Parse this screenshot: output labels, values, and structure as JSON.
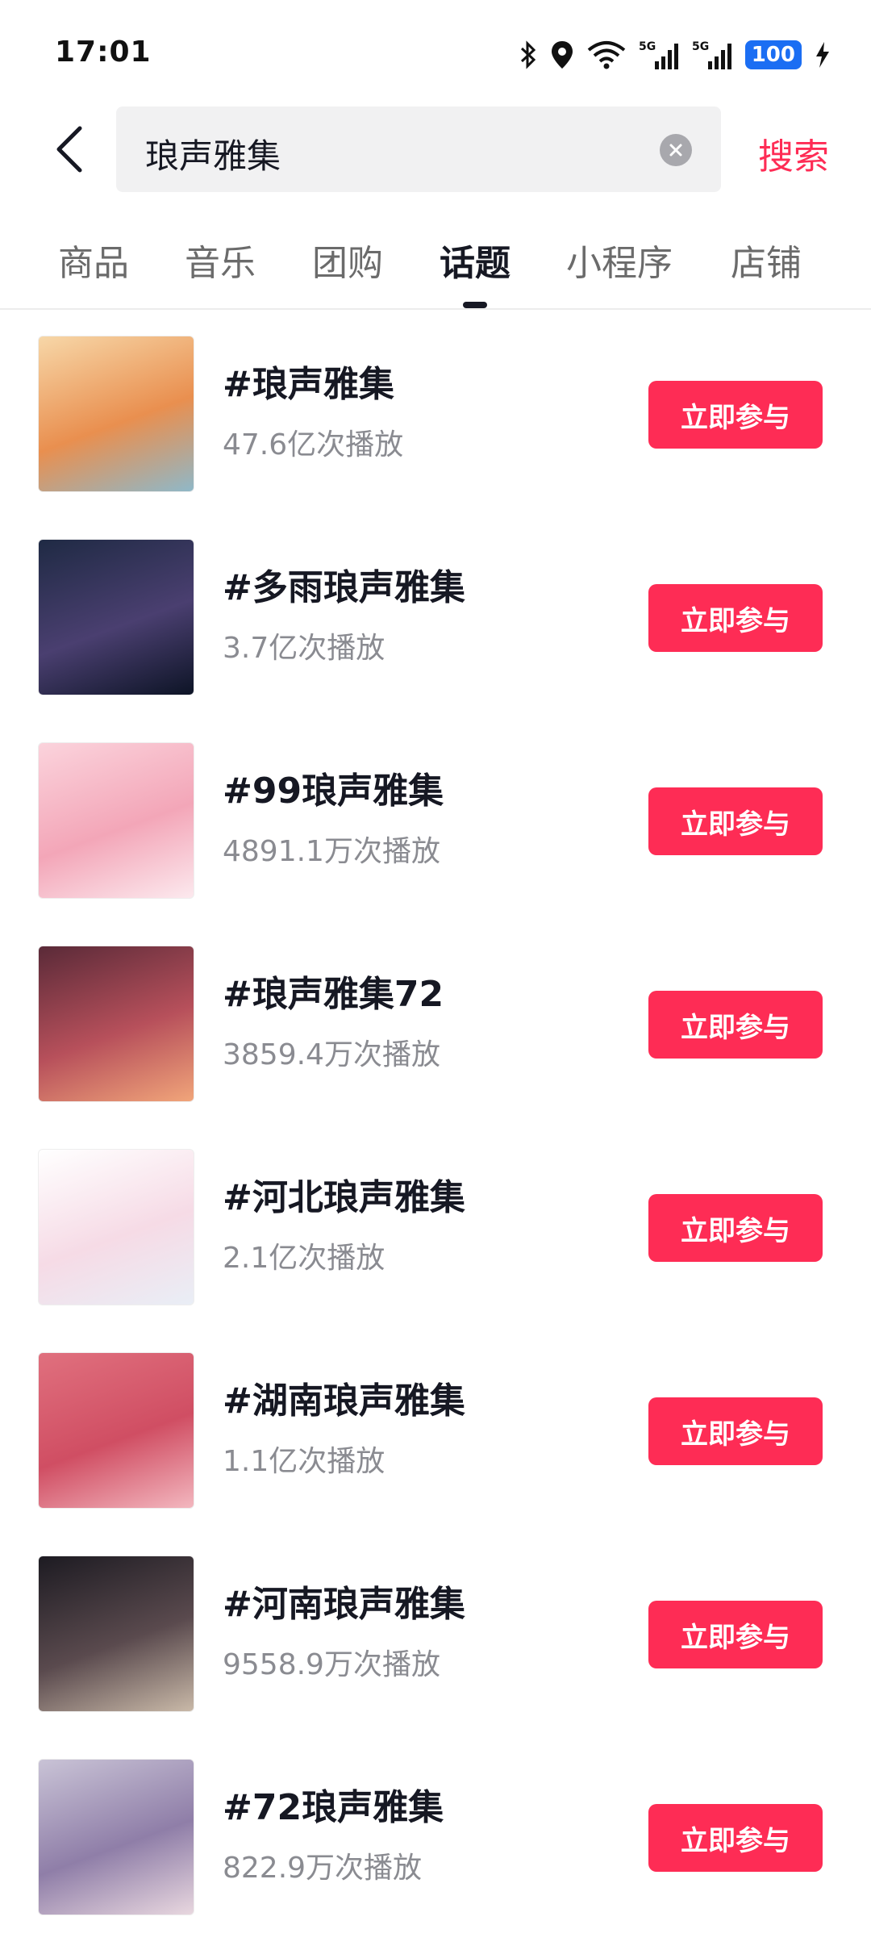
{
  "status_bar": {
    "time": "17:01",
    "battery": "100",
    "icons": [
      "bluetooth-icon",
      "location-icon",
      "wifi-icon",
      "signal-5g-icon",
      "signal-5g-icon",
      "battery-icon",
      "charging-icon"
    ]
  },
  "header": {
    "query": "琅声雅集",
    "search_label": "搜索"
  },
  "tabs": [
    {
      "label": "商品",
      "active": false
    },
    {
      "label": "音乐",
      "active": false
    },
    {
      "label": "团购",
      "active": false
    },
    {
      "label": "话题",
      "active": true
    },
    {
      "label": "小程序",
      "active": false
    },
    {
      "label": "店铺",
      "active": false
    }
  ],
  "topics": [
    {
      "title": "#琅声雅集",
      "plays": "47.6亿次播放",
      "button": "立即参与",
      "thumb_colors": [
        "#f7d7a8",
        "#e98f4f",
        "#8fb8c8"
      ]
    },
    {
      "title": "#多雨琅声雅集",
      "plays": "3.7亿次播放",
      "button": "立即参与",
      "thumb_colors": [
        "#1f2a44",
        "#4a3f70",
        "#0d1426"
      ]
    },
    {
      "title": "#99琅声雅集",
      "plays": "4891.1万次播放",
      "button": "立即参与",
      "thumb_colors": [
        "#fbd3dc",
        "#f3a6b8",
        "#fce9ee"
      ]
    },
    {
      "title": "#琅声雅集72",
      "plays": "3859.4万次播放",
      "button": "立即参与",
      "thumb_colors": [
        "#5a2a38",
        "#b7505b",
        "#f1a57a"
      ]
    },
    {
      "title": "#河北琅声雅集",
      "plays": "2.1亿次播放",
      "button": "立即参与",
      "thumb_colors": [
        "#ffffff",
        "#f6dbe6",
        "#e9eef6"
      ]
    },
    {
      "title": "#湖南琅声雅集",
      "plays": "1.1亿次播放",
      "button": "立即参与",
      "thumb_colors": [
        "#e0707e",
        "#d04e63",
        "#f3b7bf"
      ]
    },
    {
      "title": "#河南琅声雅集",
      "plays": "9558.9万次播放",
      "button": "立即参与",
      "thumb_colors": [
        "#1d1b22",
        "#5a4a4e",
        "#c9b9a8"
      ]
    },
    {
      "title": "#72琅声雅集",
      "plays": "822.9万次播放",
      "button": "立即参与",
      "thumb_colors": [
        "#c9c3d6",
        "#8f7ea8",
        "#e8d7df"
      ]
    }
  ],
  "colors": {
    "accent": "#fe2c55",
    "text_primary": "#161823",
    "text_secondary": "#8a8b91",
    "search_bg": "#f1f1f2"
  }
}
